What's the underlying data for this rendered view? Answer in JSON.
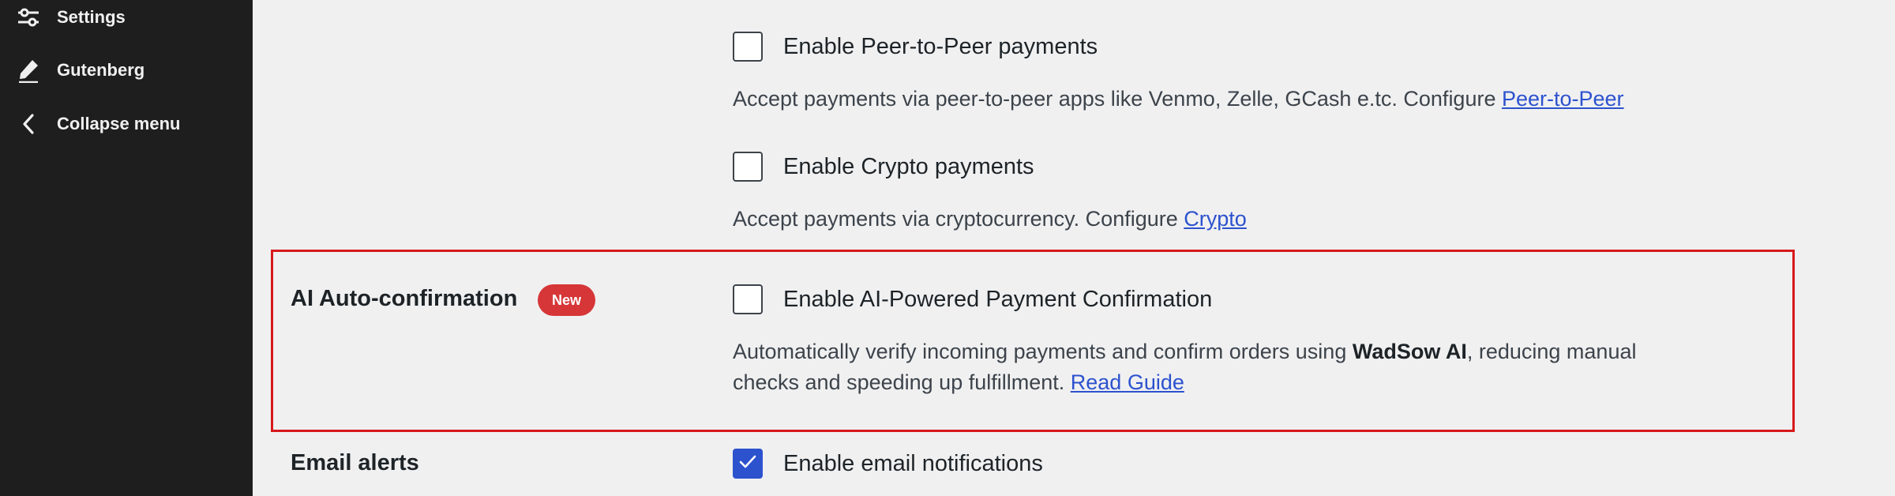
{
  "sidebar": {
    "items": [
      {
        "label": "Settings",
        "icon": "sliders-icon"
      },
      {
        "label": "Gutenberg",
        "icon": "pencil-icon"
      },
      {
        "label": "Collapse menu",
        "icon": "chevron-left-icon"
      }
    ]
  },
  "payments": {
    "p2p": {
      "checkbox_label": "Enable Peer-to-Peer payments",
      "checked": false,
      "description": "Accept payments via peer-to-peer apps like Venmo, Zelle, GCash e.tc. Configure ",
      "link": "Peer-to-Peer"
    },
    "crypto": {
      "checkbox_label": "Enable Crypto payments",
      "checked": false,
      "description": "Accept payments via cryptocurrency. Configure ",
      "link": "Crypto"
    }
  },
  "ai_section": {
    "title": "AI Auto-confirmation",
    "badge": "New",
    "checkbox_label": "Enable AI-Powered Payment Confirmation",
    "checked": false,
    "description_line1_before": "Automatically verify incoming payments and confirm orders using ",
    "description_bold": "WadSow AI",
    "description_line1_after": ", reducing manual",
    "description_line2": "checks and speeding up fulfillment. ",
    "link": "Read Guide"
  },
  "email_section": {
    "title": "Email alerts",
    "checkbox_label": "Enable email notifications",
    "checked": true
  },
  "colors": {
    "sidebar_bg": "#1e1e1e",
    "page_bg": "#f0f0f1",
    "link": "#2c52ce",
    "badge": "#d63638",
    "highlight_border": "#d7191c",
    "checked_bg": "#2c52ce"
  }
}
